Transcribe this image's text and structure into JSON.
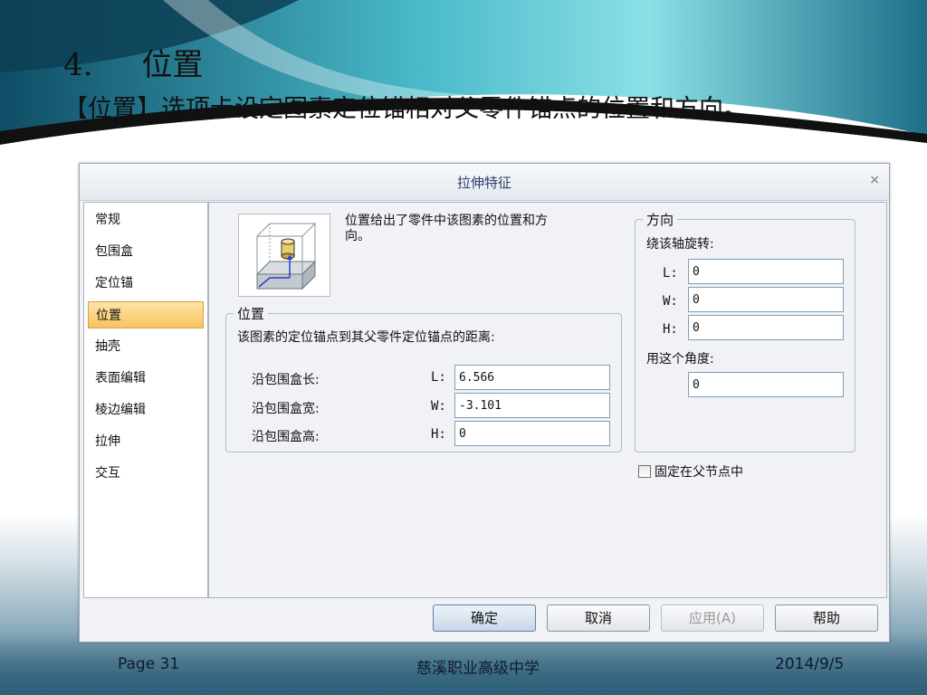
{
  "slide": {
    "title_number": "4.",
    "title_text": "位置",
    "body_text": "【位置】选项卡设定图素定位锚相对父零件锚点的位置和方向。"
  },
  "dialog": {
    "title": "拉伸特征",
    "close_glyph": "×",
    "sidebar_items": [
      {
        "label": "常规"
      },
      {
        "label": "包围盒"
      },
      {
        "label": "定位锚"
      },
      {
        "label": "位置",
        "active": true
      },
      {
        "label": "抽壳"
      },
      {
        "label": "表面编辑"
      },
      {
        "label": "棱边编辑"
      },
      {
        "label": "拉伸"
      },
      {
        "label": "交互"
      }
    ],
    "description": "位置给出了零件中该图素的位置和方向。",
    "position_group": {
      "label": "位置",
      "subtitle": "该图素的定位锚点到其父零件定位锚点的距离:",
      "rows": [
        {
          "label": "沿包围盒长:",
          "axis": "L:",
          "value": "6.566"
        },
        {
          "label": "沿包围盒宽:",
          "axis": "W:",
          "value": "-3.101"
        },
        {
          "label": "沿包围盒高:",
          "axis": "H:",
          "value": "0"
        }
      ]
    },
    "direction_group": {
      "label": "方向",
      "rotate_label": "绕该轴旋转:",
      "axes": [
        {
          "axis": "L:",
          "value": "0"
        },
        {
          "axis": "W:",
          "value": "0"
        },
        {
          "axis": "H:",
          "value": "0"
        }
      ],
      "angle_label": "用这个角度:",
      "angle_value": "0"
    },
    "fixed_checkbox": {
      "label": "固定在父节点中",
      "checked": false
    },
    "buttons": {
      "ok": "确定",
      "cancel": "取消",
      "apply": "应用(A)",
      "help": "帮助"
    }
  },
  "footer": {
    "page": "Page 31",
    "school": "慈溪职业高级中学",
    "date": "2014/9/5"
  }
}
